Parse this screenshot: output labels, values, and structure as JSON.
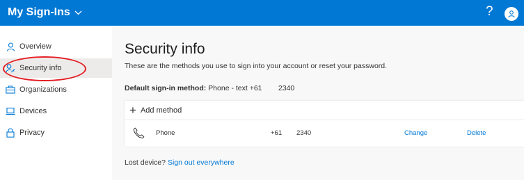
{
  "header": {
    "app_title": "My Sign-Ins",
    "help_symbol": "?",
    "bar_color": "#0078d4"
  },
  "sidebar": {
    "items": [
      {
        "label": "Overview",
        "icon": "person-icon"
      },
      {
        "label": "Security info",
        "icon": "security-key-person-icon",
        "active": true
      },
      {
        "label": "Organizations",
        "icon": "briefcase-icon"
      },
      {
        "label": "Devices",
        "icon": "laptop-icon"
      },
      {
        "label": "Privacy",
        "icon": "lock-icon"
      }
    ],
    "highlight_color": "#e31e24"
  },
  "main": {
    "title": "Security info",
    "subtitle": "These are the methods you use to sign into your account or reset your password.",
    "default_method_label": "Default sign-in method:",
    "default_method_value": " Phone - text +61        2340",
    "add_method_label": "Add method",
    "methods": [
      {
        "type": "Phone",
        "icon": "phone-icon",
        "country_code": "+61",
        "number": "2340",
        "change_label": "Change",
        "delete_label": "Delete"
      }
    ],
    "lost_device_text": "Lost device?",
    "sign_out_link": "Sign out everywhere"
  },
  "colors": {
    "accent": "#0078d4",
    "active_nav_bg": "#edebe9",
    "main_bg": "#f8f8f8"
  }
}
